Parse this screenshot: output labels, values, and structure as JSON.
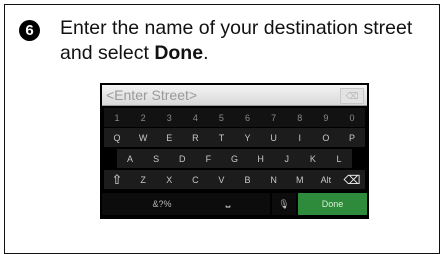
{
  "instruction": {
    "step_number": "6",
    "text_before": "Enter the name of your destination street and select ",
    "text_bold": "Done",
    "text_after": "."
  },
  "keyboard": {
    "entry_placeholder": "<Enter Street>",
    "entry_clear_glyph": "⌫",
    "row1": [
      "1",
      "2",
      "3",
      "4",
      "5",
      "6",
      "7",
      "8",
      "9",
      "0"
    ],
    "row2": [
      "Q",
      "W",
      "E",
      "R",
      "T",
      "Y",
      "U",
      "I",
      "O",
      "P"
    ],
    "row3": [
      "A",
      "S",
      "D",
      "F",
      "G",
      "H",
      "J",
      "K",
      "L"
    ],
    "row4": [
      "⇧",
      "Z",
      "X",
      "C",
      "V",
      "B",
      "N",
      "M",
      "Alt",
      "⌫"
    ],
    "symbols_label": "&?%",
    "space_glyph": "⎵",
    "voice_glyph": "🎙",
    "done_label": "Done"
  },
  "colors": {
    "done_green": "#2e8b3b",
    "keyboard_bg": "#000000"
  }
}
